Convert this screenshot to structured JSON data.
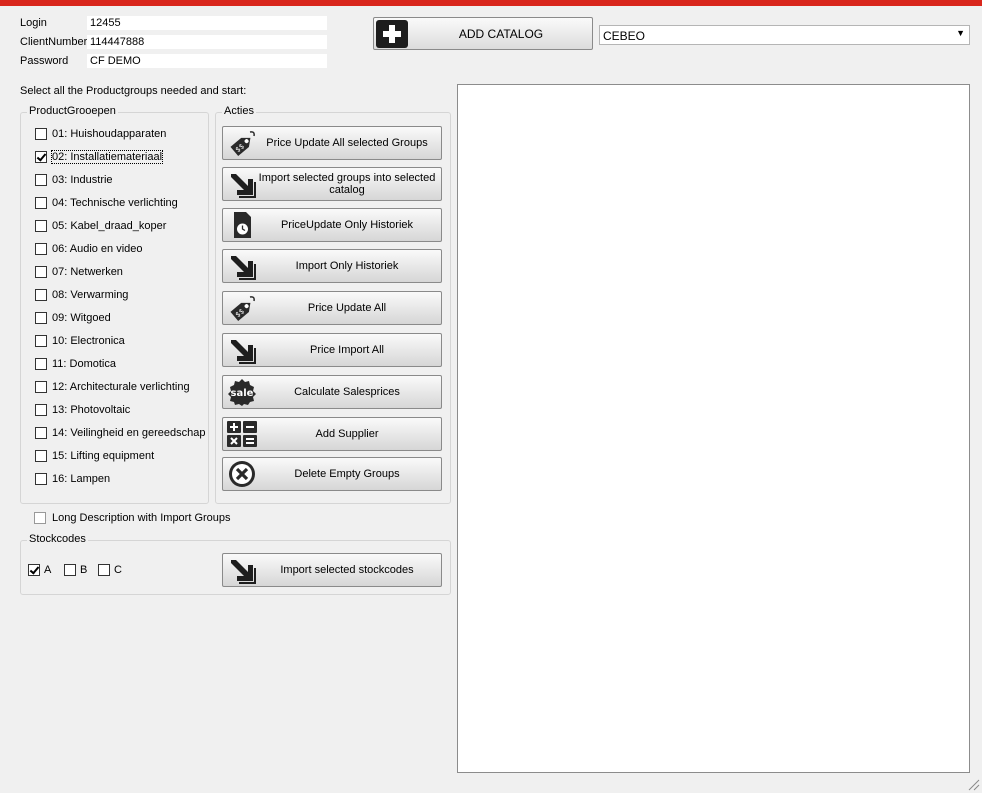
{
  "credentials": {
    "login_label": "Login",
    "login_value": "12455",
    "clientnumber_label": "ClientNumber",
    "clientnumber_value": "114447888",
    "password_label": "Password",
    "password_value": "CF DEMO"
  },
  "toolbar": {
    "add_catalog_label": "ADD CATALOG",
    "catalog_selected": "CEBEO"
  },
  "instruction": "Select all the Productgroups needed and start:",
  "productgroups": {
    "legend": "ProductGrooepen",
    "items": [
      {
        "label": "01: Huishoudapparaten",
        "checked": false
      },
      {
        "label": "02: Installatiemateriaal",
        "checked": true
      },
      {
        "label": "03: Industrie",
        "checked": false
      },
      {
        "label": "04: Technische verlichting",
        "checked": false
      },
      {
        "label": "05: Kabel_draad_koper",
        "checked": false
      },
      {
        "label": "06: Audio en video",
        "checked": false
      },
      {
        "label": "07: Netwerken",
        "checked": false
      },
      {
        "label": "08: Verwarming",
        "checked": false
      },
      {
        "label": "09: Witgoed",
        "checked": false
      },
      {
        "label": "10: Electronica",
        "checked": false
      },
      {
        "label": "11: Domotica",
        "checked": false
      },
      {
        "label": "12: Architecturale verlichting",
        "checked": false
      },
      {
        "label": "13: Photovoltaic",
        "checked": false
      },
      {
        "label": "14: Veilingheid en gereedschap",
        "checked": false
      },
      {
        "label": "15: Lifting equipment",
        "checked": false
      },
      {
        "label": "16: Lampen",
        "checked": false
      }
    ]
  },
  "actions": {
    "legend": "Acties",
    "buttons": [
      {
        "label": "Price Update All selected Groups",
        "icon": "price-tag-icon"
      },
      {
        "label": "Import selected groups into selected catalog",
        "icon": "import-arrow-icon"
      },
      {
        "label": "PriceUpdate Only Historiek",
        "icon": "document-clock-icon"
      },
      {
        "label": "Import Only Historiek",
        "icon": "import-arrow-icon"
      },
      {
        "label": "Price Update All",
        "icon": "price-tag-icon"
      },
      {
        "label": "Price Import All",
        "icon": "import-arrow-icon"
      },
      {
        "label": "Calculate Salesprices",
        "icon": "sale-badge-icon"
      },
      {
        "label": "Add Supplier",
        "icon": "calculator-icon"
      },
      {
        "label": "Delete Empty Groups",
        "icon": "delete-circle-icon"
      }
    ]
  },
  "long_description": {
    "label": "Long Description with Import Groups",
    "checked": false
  },
  "stockcodes": {
    "legend": "Stockcodes",
    "items": [
      {
        "label": "A",
        "checked": true
      },
      {
        "label": "B",
        "checked": false
      },
      {
        "label": "C",
        "checked": false
      }
    ],
    "import_label": "Import selected stockcodes"
  },
  "colors": {
    "accent_bar": "#d9261c"
  }
}
